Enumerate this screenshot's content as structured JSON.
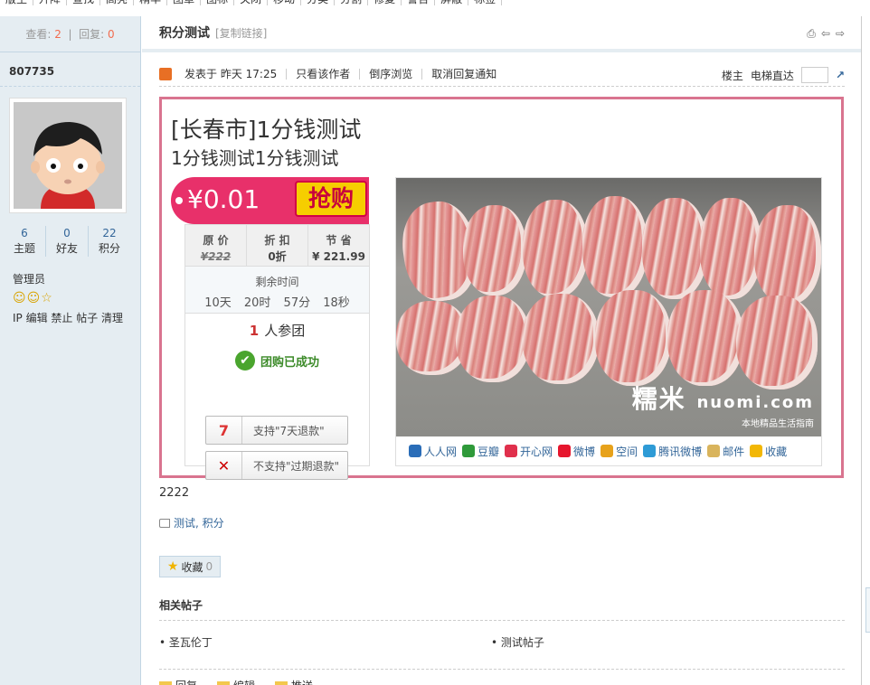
{
  "topnav": [
    "版主",
    "升降",
    "查找",
    "高亮",
    "精华",
    "图章",
    "图标",
    "关闭",
    "移动",
    "分类",
    "分割",
    "修复",
    "警告",
    "屏蔽",
    "标签"
  ],
  "sidebar": {
    "views_label": "查看:",
    "views": "2",
    "replies_label": "回复:",
    "replies": "0",
    "username": "807735",
    "stats": [
      {
        "value": "6",
        "label": "主题"
      },
      {
        "value": "0",
        "label": "好友"
      },
      {
        "value": "22",
        "label": "积分"
      }
    ],
    "role": "管理员",
    "admin_links": "IP 编辑 禁止 帖子 清理"
  },
  "header": {
    "title": "积分测试",
    "copy_link": "[复制链接]"
  },
  "post_meta": {
    "posted": "发表于 昨天 17:25",
    "only_author": "只看该作者",
    "reverse": "倒序浏览",
    "cancel_notify": "取消回复通知",
    "floor": "楼主",
    "elevator": "电梯直达"
  },
  "deal": {
    "title": "[长春市]1分钱测试",
    "subtitle": "1分钱测试1分钱测试",
    "price": "¥0.01",
    "buy_label": "抢购",
    "columns": [
      {
        "label": "原 价",
        "value": "¥222"
      },
      {
        "label": "折 扣",
        "value": "0折"
      },
      {
        "label": "节 省",
        "value": "¥ 221.99"
      }
    ],
    "remaining_label": "剩余时间",
    "remaining_time": "10天 20时 57分 18秒",
    "joined_count": "1",
    "joined_label": "人参团",
    "success_label": "团购已成功",
    "policy_refund_7d": "支持\"7天退款\"",
    "policy_expired": "不支持\"过期退款\"",
    "watermark_brand": "糯米",
    "watermark_domain": "nuomi.com",
    "watermark_slogan": "本地精品生活指南",
    "share": [
      {
        "label": "人人网",
        "color": "#2a6db8"
      },
      {
        "label": "豆瓣",
        "color": "#2f9a3a"
      },
      {
        "label": "开心网",
        "color": "#e0304c"
      },
      {
        "label": "微博",
        "color": "#e6162d"
      },
      {
        "label": "空间",
        "color": "#e7a21b"
      },
      {
        "label": "腾讯微博",
        "color": "#2e9bd6"
      },
      {
        "label": "邮件",
        "color": "#d9b45c"
      },
      {
        "label": "收藏",
        "color": "#f2b705"
      }
    ]
  },
  "post_body": "2222",
  "tags": "测试, 积分",
  "favorite": {
    "label": "收藏",
    "count": "0"
  },
  "related": {
    "title": "相关帖子",
    "items": [
      "圣瓦伦丁",
      "测试帖子"
    ]
  },
  "actions": [
    "回复",
    "编辑",
    "推送"
  ]
}
